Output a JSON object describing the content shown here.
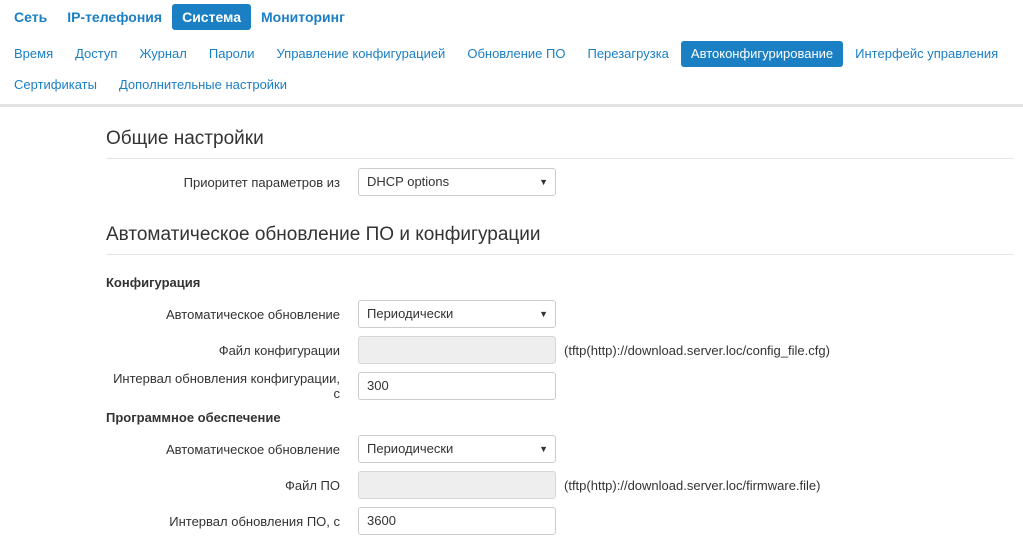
{
  "topnav": {
    "items": [
      {
        "label": "Сеть",
        "active": false
      },
      {
        "label": "IP-телефония",
        "active": false
      },
      {
        "label": "Система",
        "active": true
      },
      {
        "label": "Мониторинг",
        "active": false
      }
    ]
  },
  "subnav": {
    "row1": [
      {
        "label": "Время"
      },
      {
        "label": "Доступ"
      },
      {
        "label": "Журнал"
      },
      {
        "label": "Пароли"
      },
      {
        "label": "Управление конфигурацией"
      },
      {
        "label": "Обновление ПО"
      },
      {
        "label": "Перезагрузка"
      },
      {
        "label": "Автоконфигурирование",
        "active": true
      },
      {
        "label": "Интерфейс управления"
      }
    ],
    "row2": [
      {
        "label": "Сертификаты"
      },
      {
        "label": "Дополнительные настройки"
      }
    ]
  },
  "general": {
    "title": "Общие настройки",
    "priority_label": "Приоритет параметров из",
    "priority_value": "DHCP options"
  },
  "auto": {
    "title": "Автоматическое обновление ПО и конфигурации",
    "config": {
      "heading": "Конфигурация",
      "update_label": "Автоматическое обновление",
      "update_value": "Периодически",
      "file_label": "Файл конфигурации",
      "file_value": "",
      "file_hint": "(tftp(http)://download.server.loc/config_file.cfg)",
      "interval_label": "Интервал обновления конфигурации, с",
      "interval_value": "300"
    },
    "software": {
      "heading": "Программное обеспечение",
      "update_label": "Автоматическое обновление",
      "update_value": "Периодически",
      "file_label": "Файл ПО",
      "file_value": "",
      "file_hint": "(tftp(http)://download.server.loc/firmware.file)",
      "interval_label": "Интервал обновления ПО, с",
      "interval_value": "3600"
    }
  },
  "colors": {
    "accent": "#1b7fc4",
    "text": "#333333",
    "disabled_bg": "#eeeeee"
  },
  "icons": {
    "caret": "▼"
  }
}
